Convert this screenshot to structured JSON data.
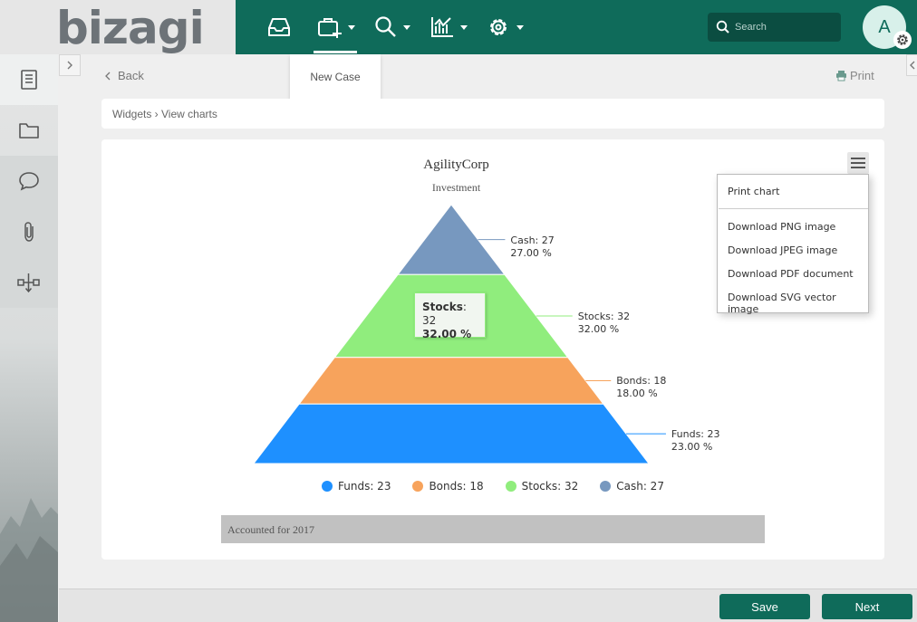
{
  "app": {
    "logo": "bizagi"
  },
  "header": {
    "new_case_label": "New Case",
    "search_placeholder": "Search",
    "avatar_initial": "A"
  },
  "toolbar": {
    "back_label": "Back",
    "print_label": "Print"
  },
  "breadcrumb": {
    "text": "Widgets › View charts"
  },
  "chart_menu": {
    "items": [
      "Print chart",
      "Download PNG image",
      "Download JPEG image",
      "Download PDF document",
      "Download SVG vector image"
    ]
  },
  "tooltip": {
    "name": "Stocks",
    "value": "32",
    "percent": "32.00 %"
  },
  "caption": "Accounted for 2017",
  "footer": {
    "save_label": "Save",
    "next_label": "Next"
  },
  "chart_data": {
    "type": "pyramid",
    "title": "AgilityCorp",
    "subtitle": "Investment",
    "points": [
      {
        "name": "Cash",
        "value": 27,
        "percent": "27.00 %",
        "color": "#7798bf"
      },
      {
        "name": "Stocks",
        "value": 32,
        "percent": "32.00 %",
        "color": "#90ed7d"
      },
      {
        "name": "Bonds",
        "value": 18,
        "percent": "18.00 %",
        "color": "#f7a35c"
      },
      {
        "name": "Funds",
        "value": 23,
        "percent": "23.00 %",
        "color": "#1e90ff"
      }
    ],
    "legend": [
      {
        "label": "Funds: 23",
        "color": "#1e90ff"
      },
      {
        "label": "Bonds: 18",
        "color": "#f7a35c"
      },
      {
        "label": "Stocks: 32",
        "color": "#90ed7d"
      },
      {
        "label": "Cash: 27",
        "color": "#7798bf"
      }
    ]
  }
}
